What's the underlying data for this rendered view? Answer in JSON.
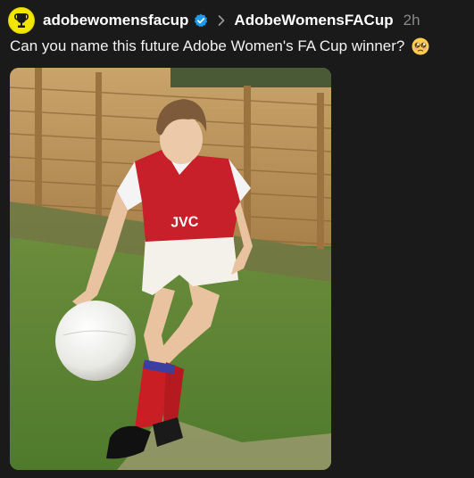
{
  "post": {
    "username": "adobewomensfacup",
    "community": "AdobeWomensFACup",
    "timestamp": "2h",
    "caption": "Can you name this future Adobe Women's FA Cup winner?",
    "caption_emoji": "pleading-face-emoji",
    "verified": true,
    "image": {
      "shirt_sponsor": "JVC"
    }
  },
  "icons": {
    "avatar": "fa-cup-trophy-icon",
    "verified": "verified-badge-icon",
    "separator": "chevron-right-icon"
  },
  "colors": {
    "background": "#1a1a1a",
    "avatar_bg": "#f2e600",
    "verified_blue": "#1d9bf0",
    "timestamp": "#8a8a8a"
  }
}
